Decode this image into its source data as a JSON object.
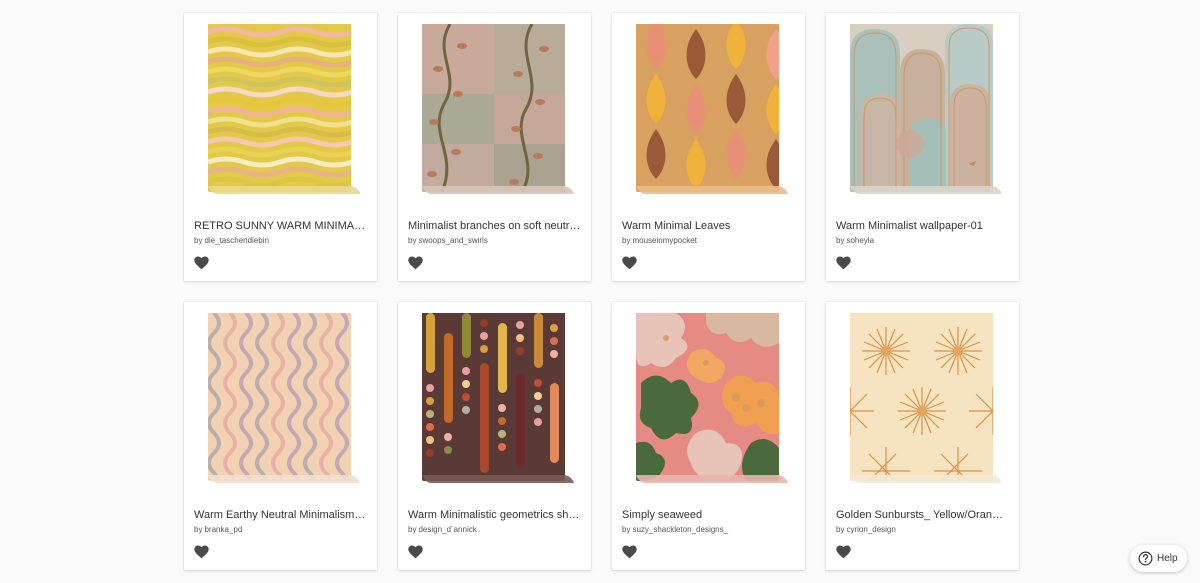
{
  "products": [
    {
      "title": "RETRO SUNNY WARM MINIMALIST",
      "by_prefix": "by",
      "designer": "die_taschendiebin",
      "favorite_icon": "heart-icon"
    },
    {
      "title": "Minimalist branches on soft neutral patchwork",
      "by_prefix": "by",
      "designer": "swoops_and_swirls",
      "favorite_icon": "heart-icon"
    },
    {
      "title": "Warm Minimal Leaves",
      "by_prefix": "by",
      "designer": "mouseinmypocket",
      "favorite_icon": "heart-icon"
    },
    {
      "title": "Warm Minimalist wallpaper-01",
      "by_prefix": "by",
      "designer": "soheyla",
      "favorite_icon": "heart-icon"
    },
    {
      "title": "Warm Earthy Neutral Minimalism - waves",
      "by_prefix": "by",
      "designer": "branka_pd",
      "favorite_icon": "heart-icon"
    },
    {
      "title": "Warm Minimalistic geometrics shapes",
      "by_prefix": "by",
      "designer": "design_d´annick",
      "favorite_icon": "heart-icon"
    },
    {
      "title": "Simply seaweed",
      "by_prefix": "by",
      "designer": "suzy_shackleton_designs_",
      "favorite_icon": "heart-icon"
    },
    {
      "title": "Golden Sunbursts_ Yellow/Orange _Small",
      "by_prefix": "by",
      "designer": "cyrion_design",
      "favorite_icon": "heart-icon"
    }
  ],
  "help": {
    "label": "Help",
    "icon": "question-circle-icon"
  },
  "colors": {
    "heart": "#4a4a4a",
    "card_bg": "#ffffff",
    "page_bg": "#fafafa"
  }
}
